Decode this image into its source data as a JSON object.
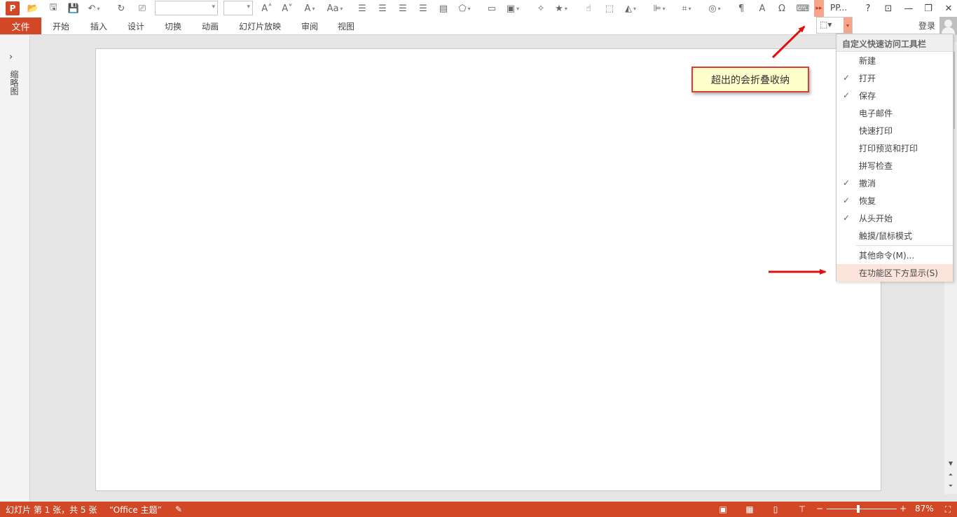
{
  "app": {
    "logo_letter": "P",
    "title": "PP...",
    "help": "?"
  },
  "ribbon": {
    "file": "文件",
    "tabs": [
      "开始",
      "插入",
      "设计",
      "切换",
      "动画",
      "幻灯片放映",
      "审阅",
      "视图"
    ],
    "login": "登录"
  },
  "thumb_pane": {
    "label": "缩略图"
  },
  "qat_menu": {
    "header": "自定义快速访问工具栏",
    "items": [
      {
        "label": "新建",
        "checked": ""
      },
      {
        "label": "打开",
        "checked": "✓"
      },
      {
        "label": "保存",
        "checked": "✓"
      },
      {
        "label": "电子邮件",
        "checked": ""
      },
      {
        "label": "快速打印",
        "checked": ""
      },
      {
        "label": "打印预览和打印",
        "checked": ""
      },
      {
        "label": "拼写检查",
        "checked": ""
      },
      {
        "label": "撤消",
        "checked": "✓"
      },
      {
        "label": "恢复",
        "checked": "✓"
      },
      {
        "label": "从头开始",
        "checked": "✓"
      },
      {
        "label": "触摸/鼠标模式",
        "checked": ""
      }
    ],
    "more_commands": "其他命令(M)...",
    "show_below": "在功能区下方显示(S)"
  },
  "callout": {
    "text": "超出的会折叠收纳"
  },
  "status": {
    "slide_info": "幻灯片 第 1 张，共 5 张",
    "theme": "“Office 主题”",
    "zoom_minus": "−",
    "zoom_plus": "+",
    "zoom": "87%"
  },
  "colors": {
    "accent": "#d24726",
    "highlight": "#fce4dc",
    "callout_border": "#e33b2e",
    "callout_fill": "#ffffcc"
  }
}
